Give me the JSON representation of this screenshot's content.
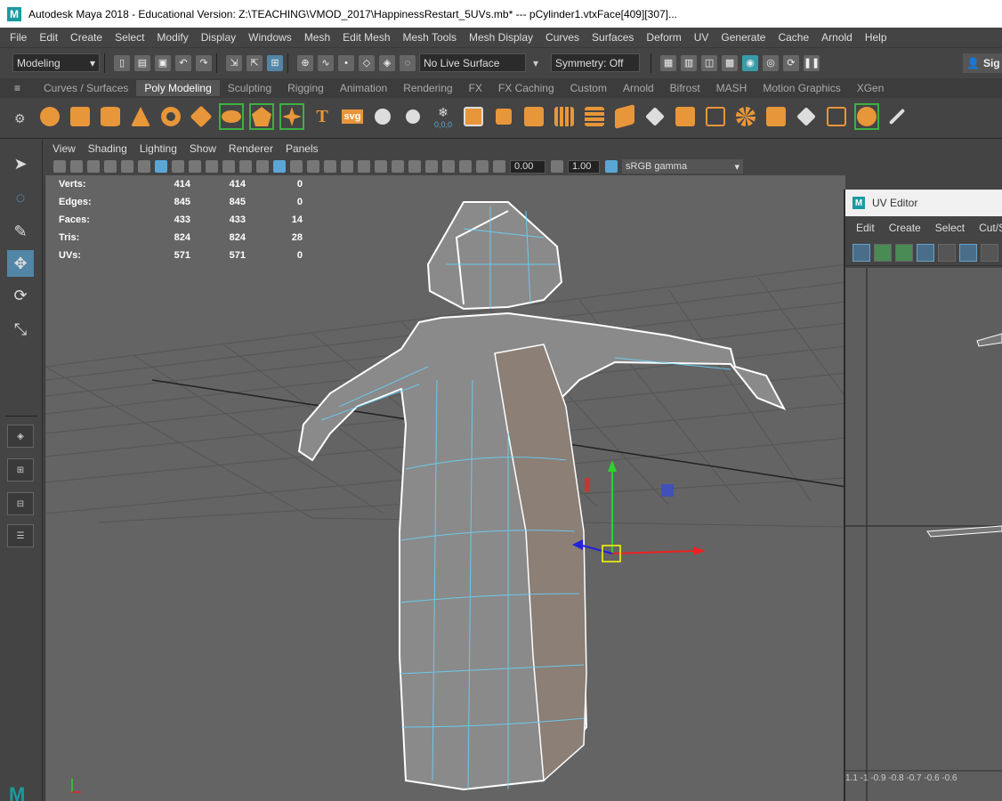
{
  "window": {
    "title": "Autodesk Maya 2018 - Educational Version: Z:\\TEACHING\\VMOD_2017\\HappinessRestart_5UVs.mb*   ---   pCylinder1.vtxFace[409][307]...",
    "logo": "M"
  },
  "menubar": [
    "File",
    "Edit",
    "Create",
    "Select",
    "Modify",
    "Display",
    "Windows",
    "Mesh",
    "Edit Mesh",
    "Mesh Tools",
    "Mesh Display",
    "Curves",
    "Surfaces",
    "Deform",
    "UV",
    "Generate",
    "Cache",
    "Arnold",
    "Help"
  ],
  "statusline": {
    "menu_set": "Modeling",
    "live_surface": "No Live Surface",
    "symmetry": "Symmetry: Off",
    "sign_in": "Sig"
  },
  "shelf_tabs": [
    "Curves / Surfaces",
    "Poly Modeling",
    "Sculpting",
    "Rigging",
    "Animation",
    "Rendering",
    "FX",
    "FX Caching",
    "Custom",
    "Arnold",
    "Bifrost",
    "MASH",
    "Motion Graphics",
    "XGen"
  ],
  "shelf_active_tab": "Poly Modeling",
  "shelf_text": {
    "type": "T",
    "svg": "svg",
    "value": "0,0,0"
  },
  "panel_menu": [
    "View",
    "Shading",
    "Lighting",
    "Show",
    "Renderer",
    "Panels"
  ],
  "panel_toolbar": {
    "exposure": "0.00",
    "gamma": "1.00",
    "color_space": "sRGB gamma"
  },
  "hud": [
    {
      "label": "Verts:",
      "a": "414",
      "b": "414",
      "c": "0"
    },
    {
      "label": "Edges:",
      "a": "845",
      "b": "845",
      "c": "0"
    },
    {
      "label": "Faces:",
      "a": "433",
      "b": "433",
      "c": "14"
    },
    {
      "label": "Tris:",
      "a": "824",
      "b": "824",
      "c": "28"
    },
    {
      "label": "UVs:",
      "a": "571",
      "b": "571",
      "c": "0"
    }
  ],
  "uv_editor": {
    "title": "UV Editor",
    "menu": [
      "Edit",
      "Create",
      "Select",
      "Cut/Sew"
    ],
    "axis_labels": "1.1  -1   -0.9  -0.8  -0.7  -0.6  -0.6"
  },
  "colors": {
    "accent_orange": "#e8963a",
    "selection_cyan": "#4fd6ff",
    "active_tool": "#5285a6"
  }
}
